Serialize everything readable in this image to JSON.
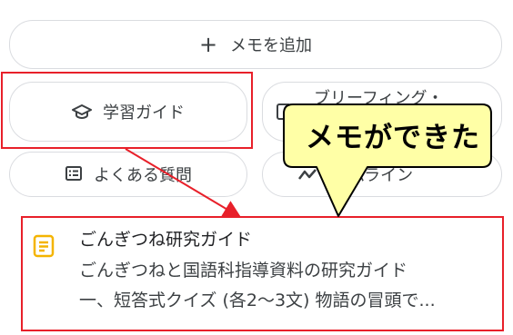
{
  "add_memo": {
    "icon": "plus-icon",
    "label": "メモを追加"
  },
  "quick_actions": {
    "study_guide": {
      "icon": "graduation-cap-icon",
      "label": "学習ガイド"
    },
    "briefing": {
      "icon": "document-icon",
      "label": "ブリーフィング・"
    },
    "faq": {
      "icon": "faq-list-icon",
      "label": "よくある質問"
    },
    "timeline": {
      "icon": "timeline-icon",
      "label": "ムライン"
    }
  },
  "note": {
    "icon": "note-icon",
    "icon_color": "#f4b400",
    "title": "ごんぎつね研究ガイド",
    "line1": "ごんぎつねと国語科指導資料の研究ガイド",
    "line2": "一、短答式クイズ (各2～3文) 物語の冒頭で..."
  },
  "annotation": {
    "callout_text": "メモができた",
    "callout_color": "#ffffa6",
    "highlight_color": "#e8202a"
  }
}
